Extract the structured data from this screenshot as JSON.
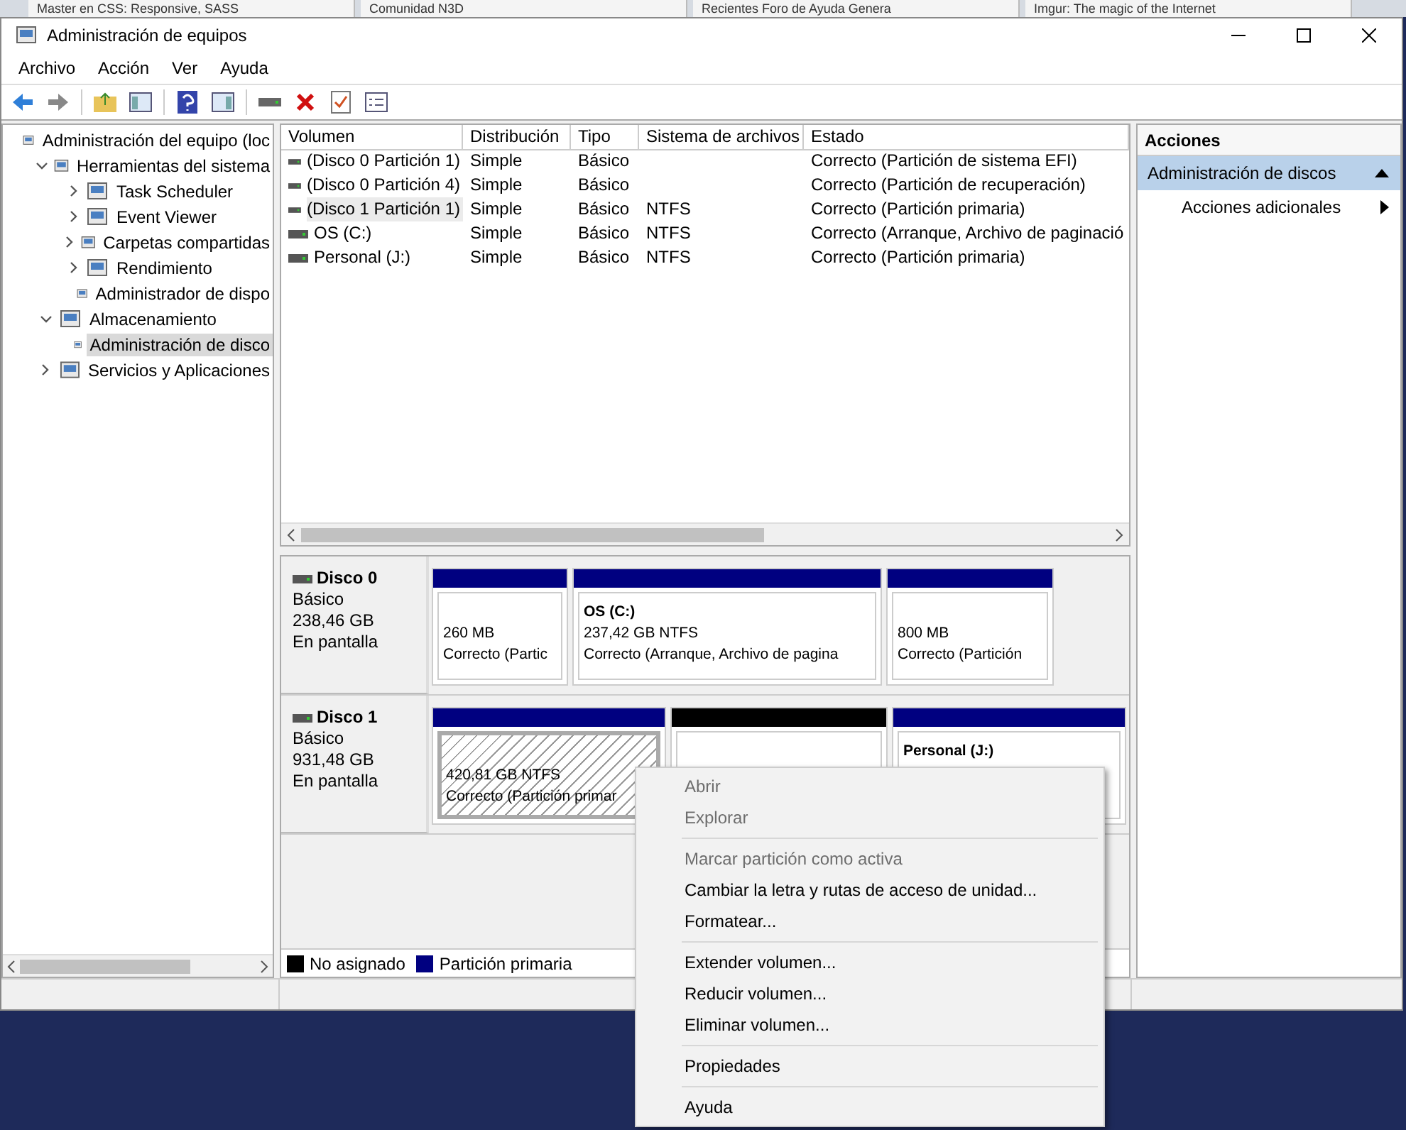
{
  "browser_tabs": [
    {
      "title": "Master en CSS: Responsive, SASS"
    },
    {
      "title": "Comunidad N3D"
    },
    {
      "title": "Recientes Foro de Ayuda Genera"
    },
    {
      "title": "Imgur: The magic of the Internet"
    }
  ],
  "window": {
    "title": "Administración de equipos"
  },
  "menu": [
    "Archivo",
    "Acción",
    "Ver",
    "Ayuda"
  ],
  "tree": [
    {
      "label": "Administración del equipo (loc",
      "selected": false,
      "children": [
        {
          "label": "Herramientas del sistema",
          "expanded": true,
          "selected": false,
          "children": [
            {
              "label": "Task Scheduler",
              "expanded": false,
              "selected": false
            },
            {
              "label": "Event Viewer",
              "expanded": false,
              "selected": false
            },
            {
              "label": "Carpetas compartidas",
              "expanded": false,
              "selected": false
            },
            {
              "label": "Rendimiento",
              "expanded": false,
              "selected": false
            },
            {
              "label": "Administrador de dispo",
              "selected": false
            }
          ]
        },
        {
          "label": "Almacenamiento",
          "expanded": true,
          "selected": false,
          "children": [
            {
              "label": "Administración de disco",
              "selected": true
            }
          ]
        },
        {
          "label": "Servicios y Aplicaciones",
          "expanded": false,
          "selected": false
        }
      ]
    }
  ],
  "table": {
    "columns": [
      "Volumen",
      "Distribución",
      "Tipo",
      "Sistema de archivos",
      "Estado"
    ],
    "rows": [
      {
        "cells": [
          "(Disco 0 Partición 1)",
          "Simple",
          "Básico",
          "",
          "Correcto (Partición de sistema EFI)"
        ],
        "selected": false
      },
      {
        "cells": [
          "(Disco 0 Partición 4)",
          "Simple",
          "Básico",
          "",
          "Correcto (Partición de recuperación)"
        ],
        "selected": false
      },
      {
        "cells": [
          "(Disco 1 Partición 1)",
          "Simple",
          "Básico",
          "NTFS",
          "Correcto (Partición primaria)"
        ],
        "selected": true
      },
      {
        "cells": [
          "OS (C:)",
          "Simple",
          "Básico",
          "NTFS",
          "Correcto (Arranque, Archivo de paginació"
        ],
        "selected": false
      },
      {
        "cells": [
          "Personal (J:)",
          "Simple",
          "Básico",
          "NTFS",
          "Correcto (Partición primaria)"
        ],
        "selected": false
      }
    ]
  },
  "disks": [
    {
      "name": "Disco 0",
      "type": "Básico",
      "size": "238,46 GB",
      "status": "En pantalla",
      "partitions": [
        {
          "kind": "primary",
          "size": "260 MB",
          "status": "Correcto (Partic",
          "selected": false
        },
        {
          "kind": "primary",
          "title": "OS  (C:)",
          "size": "237,42 GB NTFS",
          "status": "Correcto (Arranque, Archivo de pagina",
          "selected": false
        },
        {
          "kind": "primary",
          "size": "800 MB",
          "status": "Correcto (Partición",
          "selected": false
        }
      ]
    },
    {
      "name": "Disco 1",
      "type": "Básico",
      "size": "931,48 GB",
      "status": "En pantalla",
      "partitions": [
        {
          "kind": "primary",
          "size": "420,81 GB NTFS",
          "status": "Correcto (Partición primar",
          "selected": true
        },
        {
          "kind": "unallocated",
          "selected": false
        },
        {
          "kind": "primary",
          "title": "Personal  (J:)",
          "selected": false
        }
      ]
    }
  ],
  "legend": [
    {
      "label": "No asignado",
      "color": "#000000"
    },
    {
      "label": "Partición primaria",
      "color": "#000080"
    }
  ],
  "actions": {
    "title": "Acciones",
    "section": {
      "label": "Administración de discos",
      "expanded": true
    },
    "items": [
      "Acciones adicionales"
    ]
  },
  "context_menu": [
    {
      "kind": "item",
      "label": "Abrir",
      "disabled": true
    },
    {
      "kind": "item",
      "label": "Explorar",
      "disabled": true
    },
    {
      "kind": "separator"
    },
    {
      "kind": "item",
      "label": "Marcar partición como activa",
      "disabled": true
    },
    {
      "kind": "item",
      "label": "Cambiar la letra y rutas de acceso de unidad...",
      "disabled": false
    },
    {
      "kind": "item",
      "label": "Formatear...",
      "disabled": false
    },
    {
      "kind": "separator"
    },
    {
      "kind": "item",
      "label": "Extender volumen...",
      "disabled": false
    },
    {
      "kind": "item",
      "label": "Reducir volumen...",
      "disabled": false
    },
    {
      "kind": "item",
      "label": "Eliminar volumen...",
      "disabled": false
    },
    {
      "kind": "separator"
    },
    {
      "kind": "item",
      "label": "Propiedades",
      "disabled": false
    },
    {
      "kind": "separator"
    },
    {
      "kind": "item",
      "label": "Ayuda",
      "disabled": false
    }
  ]
}
